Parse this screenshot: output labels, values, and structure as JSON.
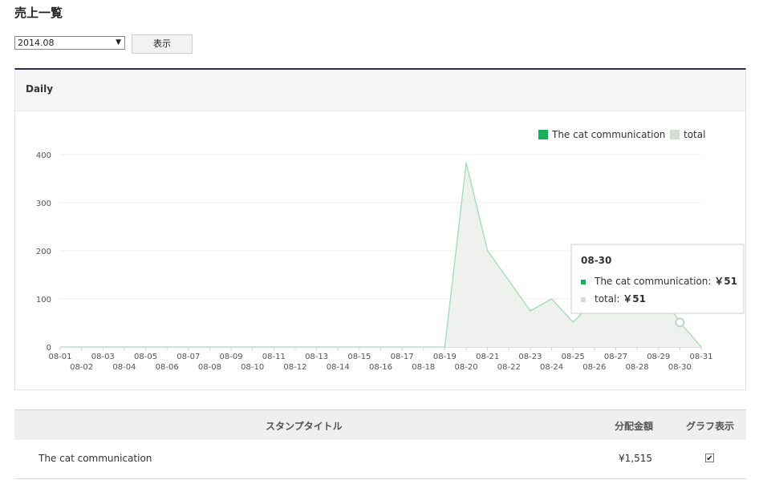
{
  "page": {
    "title": "売上一覧"
  },
  "controls": {
    "month_value": "2014.08",
    "show_button": "表示"
  },
  "panel": {
    "title": "Daily"
  },
  "chart_data": {
    "type": "area",
    "x": [
      "08-01",
      "08-02",
      "08-03",
      "08-04",
      "08-05",
      "08-06",
      "08-07",
      "08-08",
      "08-09",
      "08-10",
      "08-11",
      "08-12",
      "08-13",
      "08-14",
      "08-15",
      "08-16",
      "08-17",
      "08-18",
      "08-19",
      "08-20",
      "08-21",
      "08-22",
      "08-23",
      "08-24",
      "08-25",
      "08-26",
      "08-27",
      "08-28",
      "08-29",
      "08-30",
      "08-31"
    ],
    "series": [
      {
        "name": "The cat communication",
        "color": "#1ab05a",
        "values": [
          0,
          0,
          0,
          0,
          0,
          0,
          0,
          0,
          0,
          0,
          0,
          0,
          0,
          0,
          0,
          0,
          0,
          0,
          0,
          383,
          200,
          138,
          75,
          100,
          52,
          95,
          85,
          150,
          118,
          51,
          0
        ]
      },
      {
        "name": "total",
        "color": "#d3dcd5",
        "values": [
          0,
          0,
          0,
          0,
          0,
          0,
          0,
          0,
          0,
          0,
          0,
          0,
          0,
          0,
          0,
          0,
          0,
          0,
          0,
          383,
          200,
          138,
          75,
          100,
          52,
          95,
          85,
          150,
          118,
          51,
          0
        ]
      }
    ],
    "y_ticks": [
      0,
      100,
      200,
      300,
      400
    ],
    "ylim": [
      0,
      400
    ],
    "grid": true,
    "legend": "top-right",
    "tooltip": {
      "title": "08-30",
      "rows": [
        {
          "label": "The cat communication:",
          "value": "￥51"
        },
        {
          "label": "total:",
          "value": "￥51"
        }
      ]
    }
  },
  "table": {
    "headers": {
      "title": "スタンプタイトル",
      "amount": "分配金額",
      "graph": "グラフ表示"
    },
    "rows": [
      {
        "title": "The cat communication",
        "amount": "¥1,515",
        "graph_checked": true
      }
    ]
  }
}
